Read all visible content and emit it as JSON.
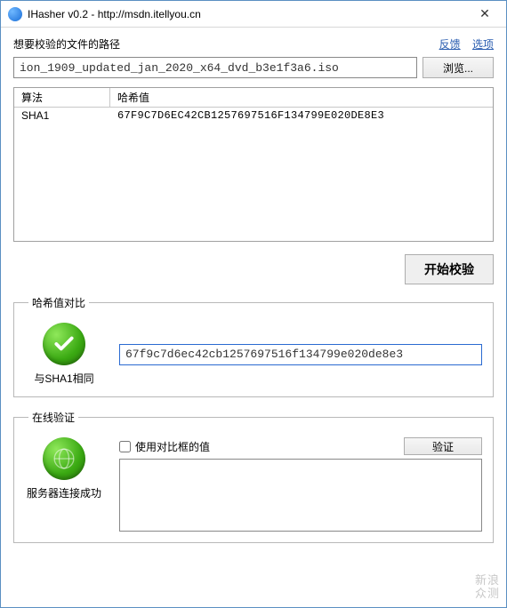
{
  "window": {
    "title": "IHasher v0.2 - http://msdn.itellyou.cn",
    "close": "✕"
  },
  "path_section": {
    "label": "想要校验的文件的路径",
    "link_feedback": "反馈",
    "link_options": "选项",
    "value": "ion_1909_updated_jan_2020_x64_dvd_b3e1f3a6.iso",
    "browse": "浏览..."
  },
  "table": {
    "col_algo": "算法",
    "col_hash": "哈希值",
    "rows": [
      {
        "algo": "SHA1",
        "hash": "67F9C7D6EC42CB1257697516F134799E020DE8E3"
      }
    ]
  },
  "start_button": "开始校验",
  "compare": {
    "legend": "哈希值对比",
    "status": "与SHA1相同",
    "input_value": "67f9c7d6ec42cb1257697516f134799e020de8e3"
  },
  "verify": {
    "legend": "在线验证",
    "checkbox_label": "使用对比框的值",
    "button": "验证",
    "status": "服务器连接成功",
    "textarea_value": ""
  },
  "watermark": {
    "line1": "新浪",
    "line2": "众测"
  }
}
